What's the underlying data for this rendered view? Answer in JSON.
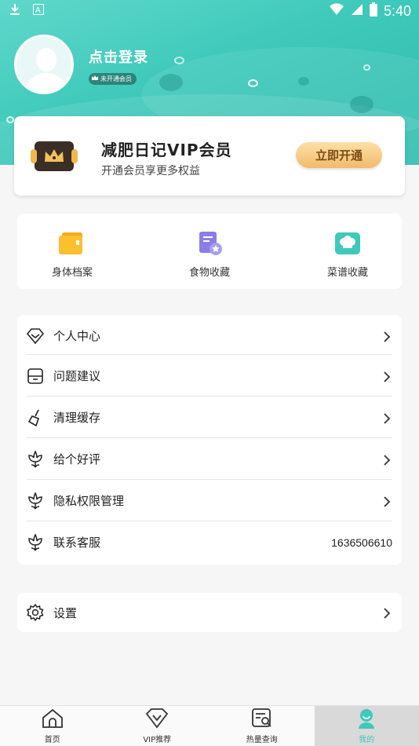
{
  "status_bar": {
    "time": "5:40",
    "icons": [
      "download-icon",
      "a-badge-icon",
      "wifi-icon",
      "signal-icon",
      "battery-icon"
    ]
  },
  "profile": {
    "login_text": "点击登录",
    "member_status": "未开通会员"
  },
  "vip_card": {
    "title": "减肥日记VIP会员",
    "subtitle": "开通会员享更多权益",
    "button_label": "立即开通",
    "accent_color": "#f1bb6a"
  },
  "quick_actions": [
    {
      "label": "身体档案",
      "icon": "folder-icon"
    },
    {
      "label": "食物收藏",
      "icon": "food-favorite-icon"
    },
    {
      "label": "菜谱收藏",
      "icon": "chef-hat-icon"
    }
  ],
  "menu": {
    "items": [
      {
        "label": "个人中心",
        "icon": "diamond-icon"
      },
      {
        "label": "问题建议",
        "icon": "inbox-icon"
      },
      {
        "label": "清理缓存",
        "icon": "broom-icon"
      },
      {
        "label": "给个好评",
        "icon": "flower-icon"
      },
      {
        "label": "隐私权限管理",
        "icon": "flower-icon"
      },
      {
        "label": "联系客服",
        "icon": "flower-icon",
        "value": "1636506610"
      }
    ]
  },
  "settings": {
    "label": "设置",
    "icon": "gear-icon"
  },
  "bottom_nav": {
    "items": [
      {
        "label": "首页",
        "icon": "home-icon"
      },
      {
        "label": "VIP推荐",
        "icon": "vip-icon"
      },
      {
        "label": "热量查询",
        "icon": "calorie-search-icon"
      },
      {
        "label": "我的",
        "icon": "profile-icon"
      }
    ],
    "active_index": 3
  },
  "colors": {
    "brand": "#3ec9ba",
    "background": "#f6f6f6"
  }
}
